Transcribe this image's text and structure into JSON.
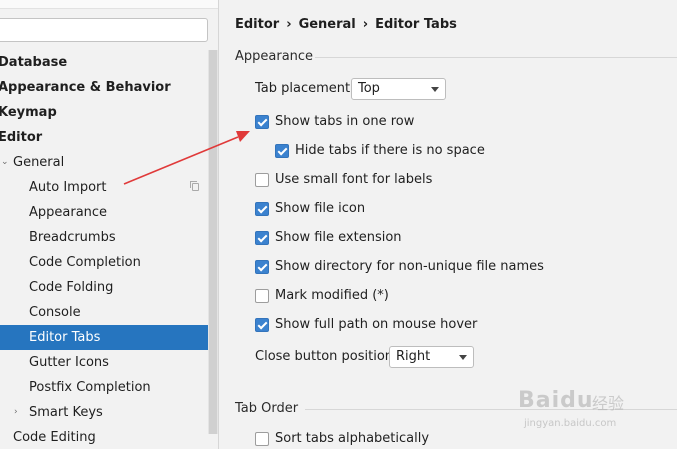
{
  "search": {
    "value": "",
    "placeholder": ""
  },
  "sidebar": {
    "items": [
      {
        "label": "Database"
      },
      {
        "label": "Appearance & Behavior"
      },
      {
        "label": "Keymap"
      },
      {
        "label": "Editor"
      },
      {
        "label": "General"
      },
      {
        "label": "Auto Import"
      },
      {
        "label": "Appearance"
      },
      {
        "label": "Breadcrumbs"
      },
      {
        "label": "Code Completion"
      },
      {
        "label": "Code Folding"
      },
      {
        "label": "Console"
      },
      {
        "label": "Editor Tabs"
      },
      {
        "label": "Gutter Icons"
      },
      {
        "label": "Postfix Completion"
      },
      {
        "label": "Smart Keys"
      },
      {
        "label": "Code Editing"
      }
    ],
    "selected": "Editor Tabs"
  },
  "breadcrumb": {
    "items": [
      "Editor",
      "General",
      "Editor Tabs"
    ],
    "separator": "›"
  },
  "appearance": {
    "title": "Appearance",
    "tab_placement_label": "Tab placement:",
    "tab_placement_value": "Top",
    "options": [
      {
        "label": "Show tabs in one row",
        "checked": true
      },
      {
        "label": "Hide tabs if there is no space",
        "checked": true
      },
      {
        "label": "Use small font for labels",
        "checked": false
      },
      {
        "label": "Show file icon",
        "checked": true
      },
      {
        "label": "Show file extension",
        "checked": true
      },
      {
        "label": "Show directory for non-unique file names",
        "checked": true
      },
      {
        "label": "Mark modified (*)",
        "checked": false
      },
      {
        "label": "Show full path on mouse hover",
        "checked": true
      }
    ],
    "close_button_label": "Close button position:",
    "close_button_value": "Right"
  },
  "tab_order": {
    "title": "Tab Order",
    "options": [
      {
        "label": "Sort tabs alphabetically",
        "checked": false
      }
    ]
  },
  "watermark": {
    "brand": "Baidu",
    "cn": "经验",
    "url": "jingyan.baidu.com"
  },
  "colors": {
    "selection": "#2675bf",
    "checkbox": "#3b82cf",
    "annotation_arrow": "#e03a3a"
  }
}
